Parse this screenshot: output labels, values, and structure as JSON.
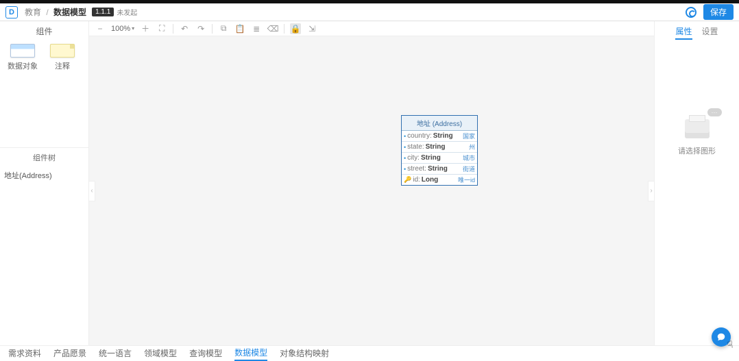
{
  "header": {
    "logo_letter": "D",
    "breadcrumb_root": "教育",
    "breadcrumb_current": "数据模型",
    "version": "1.1.1",
    "status": "未发起",
    "save_label": "保存"
  },
  "left_panel": {
    "title": "组件",
    "items": [
      {
        "label": "数据对象"
      },
      {
        "label": "注释"
      }
    ],
    "tree_title": "组件树",
    "tree_items": [
      {
        "label": "地址(Address)"
      }
    ]
  },
  "toolbar": {
    "zoom": "100%"
  },
  "entity": {
    "title": "地址 (Address)",
    "rows": [
      {
        "name": "country",
        "type": "String",
        "desc": "国家",
        "key": false
      },
      {
        "name": "state",
        "type": "String",
        "desc": "州",
        "key": false
      },
      {
        "name": "city",
        "type": "String",
        "desc": "城市",
        "key": false
      },
      {
        "name": "street",
        "type": "String",
        "desc": "街道",
        "key": false
      },
      {
        "name": "id",
        "type": "Long",
        "desc": "唯一id",
        "key": true
      }
    ]
  },
  "right_panel": {
    "tabs": [
      {
        "label": "属性",
        "active": true
      },
      {
        "label": "设置",
        "active": false
      }
    ],
    "empty_badge": "···",
    "empty_text": "请选择图形"
  },
  "bottom_tabs": [
    {
      "label": "需求资料",
      "active": false
    },
    {
      "label": "产品愿景",
      "active": false
    },
    {
      "label": "统一语言",
      "active": false
    },
    {
      "label": "领域模型",
      "active": false
    },
    {
      "label": "查询模型",
      "active": false
    },
    {
      "label": "数据模型",
      "active": true
    },
    {
      "label": "对象结构映射",
      "active": false
    }
  ]
}
